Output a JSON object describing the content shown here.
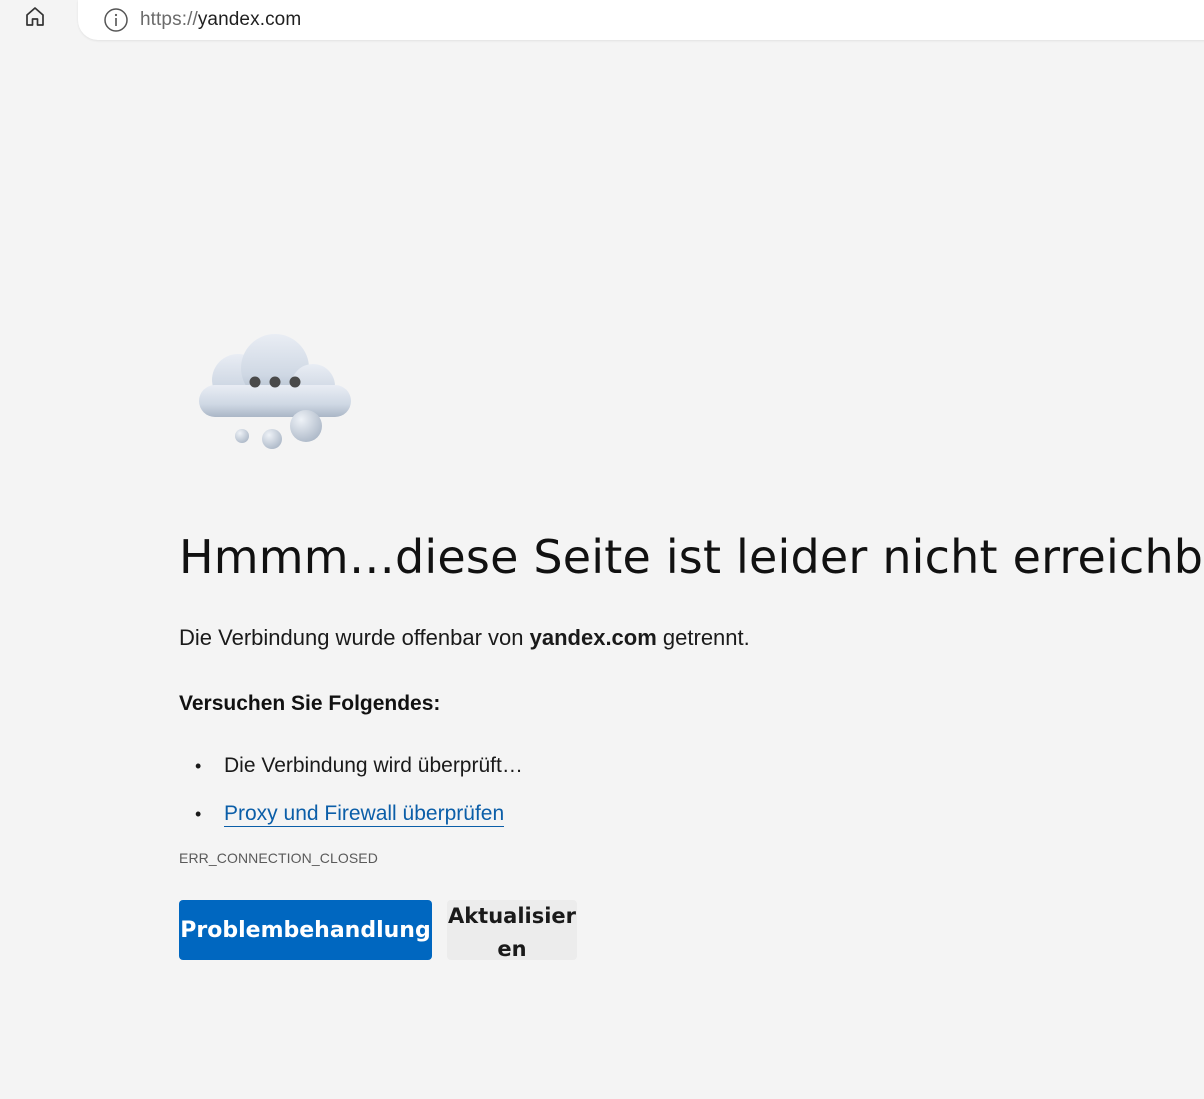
{
  "toolbar": {
    "home_icon": "home-icon",
    "info_icon": "info-icon",
    "url_scheme": "https://",
    "url_host": "yandex.com"
  },
  "error": {
    "title": "Hmmm…diese Seite ist leider nicht erreichbar",
    "subtitle_prefix": "Die Verbindung wurde offenbar von ",
    "subtitle_host": "yandex.com",
    "subtitle_suffix": " getrennt.",
    "try_heading": "Versuchen Sie Folgendes:",
    "suggestions": [
      {
        "text": "Die Verbindung wird überprüft…",
        "link": false
      },
      {
        "text": "Proxy und Firewall überprüfen",
        "link": true
      }
    ],
    "code": "ERR_CONNECTION_CLOSED"
  },
  "buttons": {
    "primary_label": "Problembehandlung",
    "secondary_label": "Aktualisieren"
  },
  "colors": {
    "page_bg": "#f4f4f4",
    "primary_button": "#0067c0",
    "link": "#0b5ea8"
  },
  "illustration": "cloud-thinking-icon"
}
